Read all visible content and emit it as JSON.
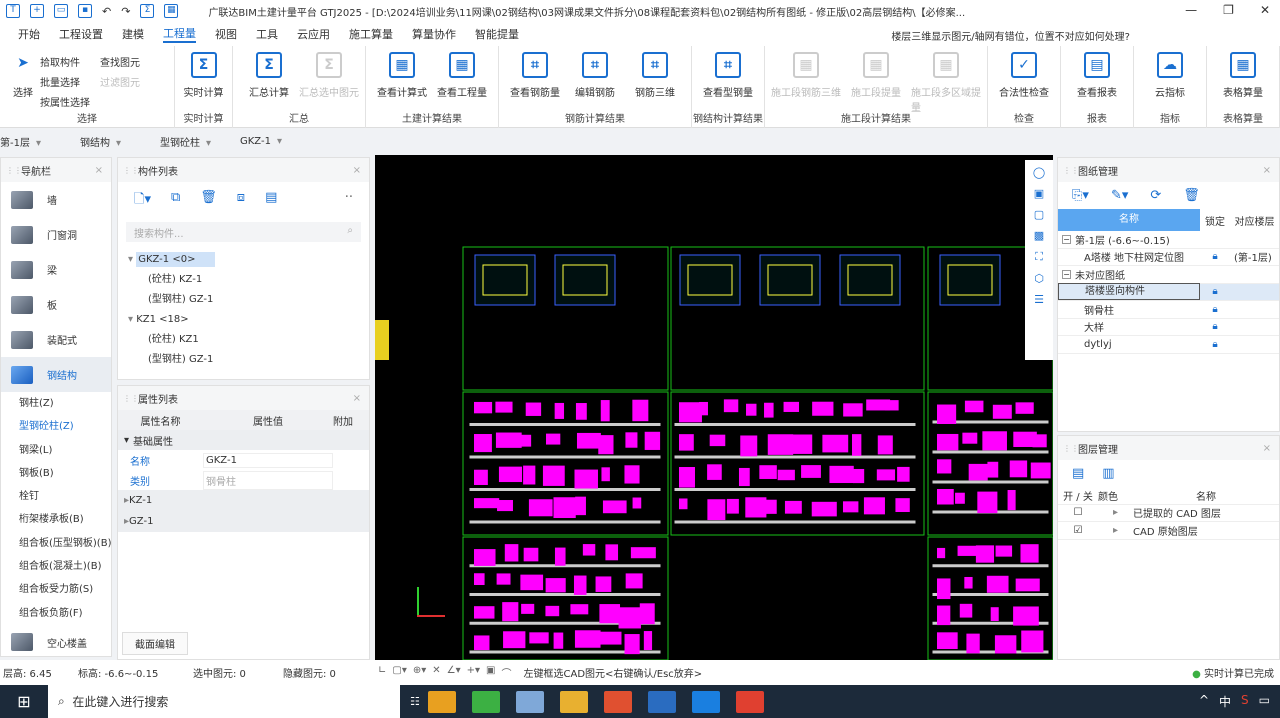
{
  "title": "广联达BIM土建计量平台 GTJ2025 - [D:\\2024培训业务\\11网课\\02钢结构\\03网课成果文件拆分\\08课程配套资料包\\02钢结构所有图纸 - 修正版\\02高层钢结构\\【必修案...",
  "tabs": [
    "开始",
    "工程设置",
    "建模",
    "工程量",
    "视图",
    "工具",
    "云应用",
    "施工算量",
    "算量协作",
    "智能提量"
  ],
  "help": "楼层三维显示图元/轴网有错位，位置不对应如何处理?",
  "ribbon": {
    "select": {
      "big": "选择",
      "items": [
        "拾取构件",
        "批量选择",
        "按属性选择"
      ],
      "items2": [
        "查找图元",
        "过滤图元"
      ],
      "label": "选择"
    },
    "realtime": {
      "btn": "实时计算",
      "label": "实时计算"
    },
    "summary": {
      "btns": [
        "汇总计算",
        "汇总选中图元"
      ],
      "label": "汇总"
    },
    "civil": {
      "btns": [
        "查看计算式",
        "查看工程量"
      ],
      "label": "土建计算结果"
    },
    "rebar": {
      "btns": [
        "查看钢筋量",
        "编辑钢筋",
        "钢筋三维"
      ],
      "label": "钢筋计算结果"
    },
    "steel": {
      "btns": [
        "查看型钢量"
      ],
      "label": "钢结构计算结果"
    },
    "construct": {
      "btns": [
        "施工段钢筋三维",
        "施工段提量",
        "施工段多区域提量"
      ],
      "label": "施工段计算结果"
    },
    "check": {
      "btns": [
        "合法性检查"
      ],
      "label": "检查"
    },
    "report": {
      "btns": [
        "查看报表"
      ],
      "label": "报表"
    },
    "index": {
      "btns": [
        "云指标"
      ],
      "label": "指标"
    },
    "table": {
      "btns": [
        "表格算量"
      ],
      "label": "表格算量"
    }
  },
  "breadcrumb": [
    "第-1层",
    "钢结构",
    "型钢砼柱",
    "GKZ-1"
  ],
  "nav": {
    "title": "导航栏",
    "big": [
      "墙",
      "门窗洞",
      "梁",
      "板",
      "装配式",
      "钢结构"
    ],
    "sub": [
      "钢柱(Z)",
      "型钢砼柱(Z)",
      "钢梁(L)",
      "钢板(B)",
      "栓钉",
      "桁架楼承板(B)",
      "组合板(压型钢板)(B)",
      "组合板(混凝土)(B)",
      "组合板受力筋(S)",
      "组合板负筋(F)"
    ],
    "bottom": "空心楼盖"
  },
  "components": {
    "title": "构件列表",
    "search_placeholder": "搜索构件...",
    "tree": [
      {
        "t": "GKZ-1 <0>",
        "lvl": 0,
        "sel": true
      },
      {
        "t": "(砼柱) KZ-1",
        "lvl": 1
      },
      {
        "t": "(型钢柱) GZ-1",
        "lvl": 1
      },
      {
        "t": "KZ1 <18>",
        "lvl": 0
      },
      {
        "t": "(砼柱) KZ1",
        "lvl": 1
      },
      {
        "t": "(型钢柱) GZ-1",
        "lvl": 1
      }
    ]
  },
  "properties": {
    "title": "属性列表",
    "cols": [
      "属性名称",
      "属性值",
      "附加"
    ],
    "group": "基础属性",
    "rows": [
      {
        "k": "名称",
        "v": "GKZ-1"
      },
      {
        "k": "类别",
        "v": "钢骨柱"
      }
    ],
    "subgroups": [
      "KZ-1",
      "GZ-1"
    ],
    "section_btn": "截面编辑"
  },
  "drawings": {
    "title": "图纸管理",
    "cols": [
      "名称",
      "锁定",
      "对应楼层"
    ],
    "rows": [
      {
        "n": "第-1层 (-6.6~-0.15)",
        "g": true
      },
      {
        "n": "A塔楼 地下柱网定位图",
        "f": "(第-1层)"
      },
      {
        "n": "未对应图纸",
        "g": true
      },
      {
        "n": "塔楼竖向构件",
        "sel": true
      },
      {
        "n": "钢骨柱"
      },
      {
        "n": "大样"
      },
      {
        "n": "dytlyj"
      }
    ]
  },
  "layers": {
    "title": "图层管理",
    "cols": [
      "开 / 关",
      "颜色",
      "名称"
    ],
    "rows": [
      {
        "n": "已提取的 CAD 图层",
        "on": false
      },
      {
        "n": "CAD 原始图层",
        "on": true
      }
    ]
  },
  "status": {
    "height": "层高: 6.45",
    "elev": "标高: -6.6~-0.15",
    "selected": "选中图元: 0",
    "hidden": "隐藏图元: 0",
    "hint": "左键框选CAD图元<右键确认/Esc放弃>",
    "calc": "实时计算已完成"
  },
  "taskbar": {
    "search": "在此键入进行搜索",
    "ime": "中"
  },
  "colors": {
    "accent": "#1a6fd0",
    "cad_green": "#18c018",
    "cad_magenta": "#ff00ff"
  }
}
